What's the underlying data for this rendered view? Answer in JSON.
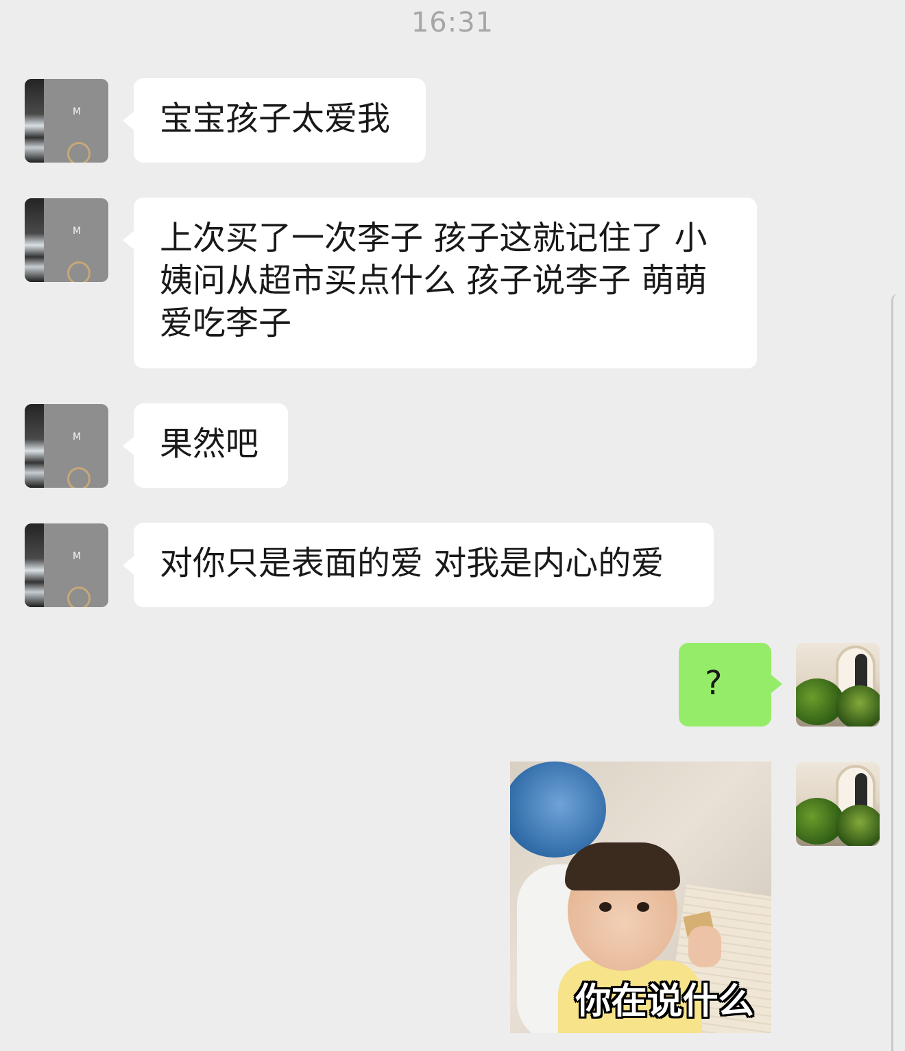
{
  "chat": {
    "timestamp": "16:31",
    "messages": [
      {
        "side": "left",
        "text": "宝宝孩子太爱我"
      },
      {
        "side": "left",
        "text": "上次买了一次李子 孩子这就记住了 小姨问从超市买点什么 孩子说李子 萌萌爱吃李子"
      },
      {
        "side": "left",
        "text": "果然吧"
      },
      {
        "side": "left",
        "text": "对你只是表面的爱 对我是内心的爱"
      },
      {
        "side": "right",
        "text": "?"
      },
      {
        "side": "right",
        "type": "sticker",
        "caption": "你在说什么"
      }
    ]
  },
  "colors": {
    "background": "#ededed",
    "incoming_bubble": "#ffffff",
    "outgoing_bubble": "#95ec69",
    "timestamp": "#a6a6a6"
  }
}
